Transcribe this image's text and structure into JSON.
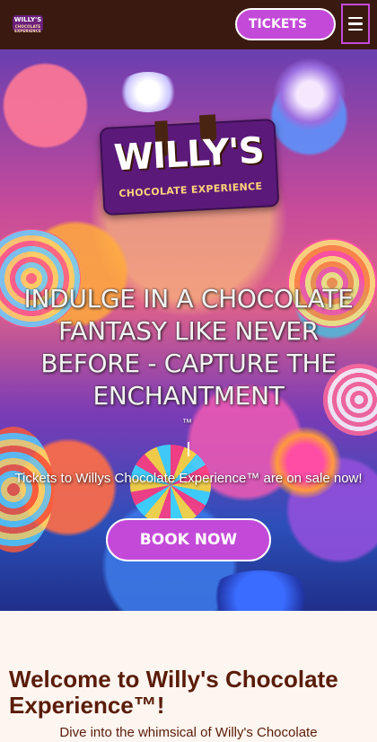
{
  "header": {
    "logo_line1": "WILLY'S",
    "logo_line2": "CHOCOLATE EXPERIENCE",
    "tickets_label": "TICKETS",
    "menu_icon": "hamburger-menu-icon"
  },
  "hero": {
    "logo_title": "WILLY'S",
    "logo_subtitle": "CHOCOLATE EXPERIENCE",
    "headline": "INDULGE IN A CHOCOLATE FANTASY LIKE NEVER BEFORE - CAPTURE THE ENCHANTMENT",
    "trademark": "™",
    "subtext": "Tickets to Willys Chocolate Experience™ are on sale now!",
    "cta_label": "BOOK NOW"
  },
  "main": {
    "welcome_heading": "Welcome to Willy's Chocolate Experience™!",
    "intro_text": "Dive into the whimsical of Willy's Chocolate"
  },
  "colors": {
    "topbar": "#3a1a10",
    "accent": "#c34ad8",
    "page_bg": "#fdf5f0",
    "heading_text": "#5a1c08"
  }
}
